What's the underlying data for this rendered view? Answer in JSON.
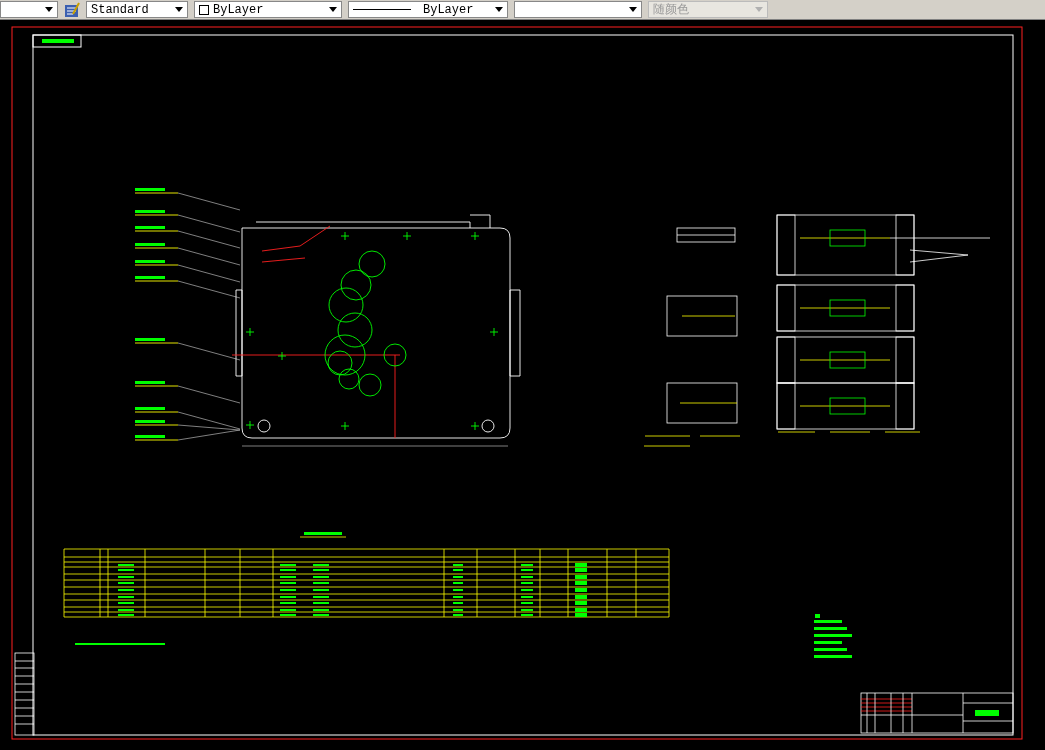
{
  "toolbar": {
    "dropdowns": [
      {
        "kind": "blank",
        "disabled": false
      },
      {
        "kind": "textstyle",
        "value": "Standard",
        "disabled": false
      },
      {
        "kind": "color",
        "value": "ByLayer",
        "disabled": false
      },
      {
        "kind": "linetype",
        "value": "ByLayer",
        "disabled": false
      },
      {
        "kind": "blank",
        "disabled": false
      },
      {
        "kind": "plotstyle",
        "value": "随颜色",
        "disabled": true
      }
    ]
  }
}
